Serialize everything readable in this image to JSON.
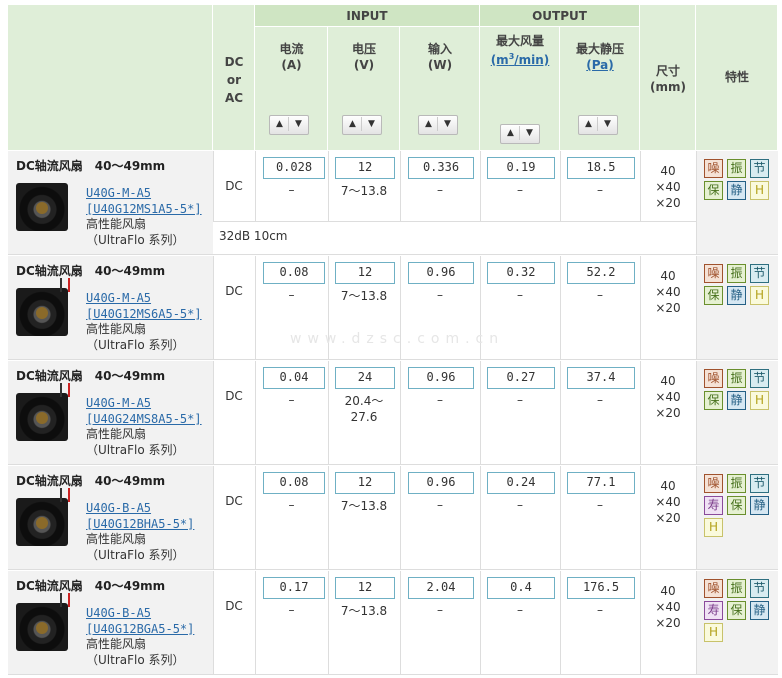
{
  "header": {
    "group_input": "INPUT",
    "group_output": "OUTPUT",
    "dc_ac": [
      "DC",
      "or",
      "AC"
    ],
    "current": [
      "电流",
      "(A)"
    ],
    "voltage": [
      "电压",
      "(V)"
    ],
    "power": [
      "输入",
      "(W)"
    ],
    "airflow": [
      "最大风量",
      "(m3/min)"
    ],
    "pressure": [
      "最大静压",
      "(Pa)"
    ],
    "size": [
      "尺寸",
      "(mm)"
    ],
    "features": "特性"
  },
  "rows": [
    {
      "title": "DC轴流风扇　40～49mm",
      "model": [
        "U40G-M-A5",
        "[U40G12MS1A5-5*]"
      ],
      "desc": [
        "高性能风扇",
        "（UltraFlo 系列）"
      ],
      "dcac": "DC",
      "current": "0.028",
      "voltage": "12",
      "voltage_range": "7～13.8",
      "power": "0.336",
      "airflow": "0.19",
      "pressure": "18.5",
      "dash": "–",
      "size": [
        "40",
        "×40",
        "×20"
      ],
      "features": [
        "噪",
        "振",
        "节",
        "保",
        "静",
        "H"
      ],
      "note": "32dB 10cm"
    },
    {
      "title": "DC轴流风扇　40～49mm",
      "model": [
        "U40G-M-A5",
        "[U40G12MS6A5-5*]"
      ],
      "desc": [
        "高性能风扇",
        "（UltraFlo 系列）"
      ],
      "dcac": "DC",
      "current": "0.08",
      "voltage": "12",
      "voltage_range": "7～13.8",
      "power": "0.96",
      "airflow": "0.32",
      "pressure": "52.2",
      "dash": "–",
      "size": [
        "40",
        "×40",
        "×20"
      ],
      "features": [
        "噪",
        "振",
        "节",
        "保",
        "静",
        "H"
      ],
      "watermark": "www.dzsc.com.cn"
    },
    {
      "title": "DC轴流风扇　40～49mm",
      "model": [
        "U40G-M-A5",
        "[U40G24MS8A5-5*]"
      ],
      "desc": [
        "高性能风扇",
        "（UltraFlo 系列）"
      ],
      "dcac": "DC",
      "current": "0.04",
      "voltage": "24",
      "voltage_range": "20.4～\n27.6",
      "power": "0.96",
      "airflow": "0.27",
      "pressure": "37.4",
      "dash": "–",
      "size": [
        "40",
        "×40",
        "×20"
      ],
      "features": [
        "噪",
        "振",
        "节",
        "保",
        "静",
        "H"
      ]
    },
    {
      "title": "DC轴流风扇　40～49mm",
      "model": [
        "U40G-B-A5",
        "[U40G12BHA5-5*]"
      ],
      "desc": [
        "高性能风扇",
        "（UltraFlo 系列）"
      ],
      "dcac": "DC",
      "current": "0.08",
      "voltage": "12",
      "voltage_range": "7～13.8",
      "power": "0.96",
      "airflow": "0.24",
      "pressure": "77.1",
      "dash": "–",
      "size": [
        "40",
        "×40",
        "×20"
      ],
      "features": [
        "噪",
        "振",
        "节",
        "寿",
        "保",
        "静",
        "H"
      ]
    },
    {
      "title": "DC轴流风扇　40～49mm",
      "model": [
        "U40G-B-A5",
        "[U40G12BGA5-5*]"
      ],
      "desc": [
        "高性能风扇",
        "（UltraFlo 系列）"
      ],
      "dcac": "DC",
      "current": "0.17",
      "voltage": "12",
      "voltage_range": "7～13.8",
      "power": "2.04",
      "airflow": "0.4",
      "pressure": "176.5",
      "dash": "–",
      "size": [
        "40",
        "×40",
        "×20"
      ],
      "features": [
        "噪",
        "振",
        "节",
        "寿",
        "保",
        "静",
        "H"
      ]
    }
  ]
}
